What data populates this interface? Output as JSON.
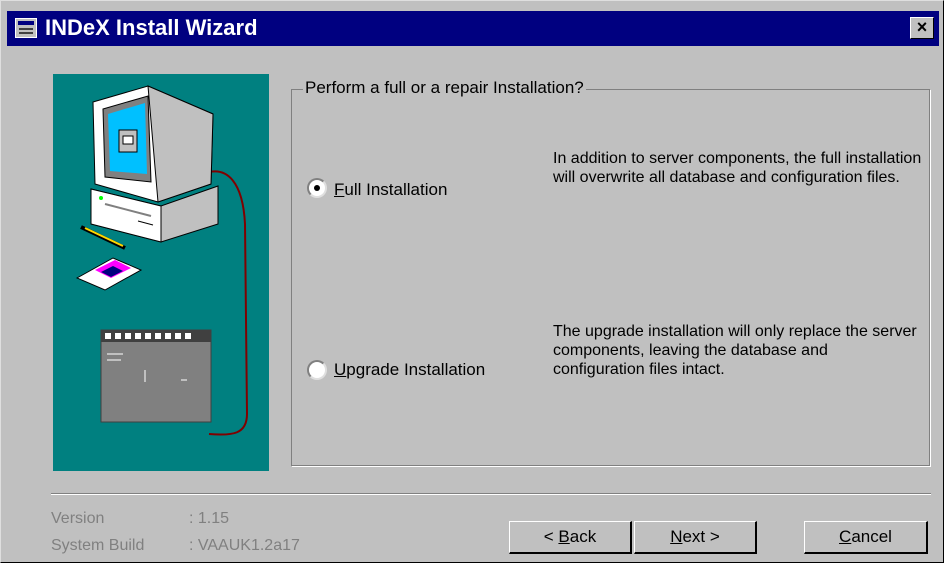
{
  "window": {
    "title": "INDeX Install Wizard",
    "close_label": "×"
  },
  "group": {
    "legend": "Perform a full  or a repair Installation?"
  },
  "options": [
    {
      "label_accel": "F",
      "label_rest": "ull Installation",
      "selected": true,
      "description": "In addition to server components, the full installation will overwrite all database and configuration files."
    },
    {
      "label_accel": "U",
      "label_rest": "pgrade Installation",
      "selected": false,
      "description": "The upgrade installation will only replace the server components, leaving the database and configuration files intact."
    }
  ],
  "info": {
    "version_label": "Version",
    "version_value": ": 1.15",
    "build_label": "System Build",
    "build_value": ": VAAUK1.2a17"
  },
  "buttons": {
    "back_prefix": "< ",
    "back_accel": "B",
    "back_rest": "ack",
    "next_accel": "N",
    "next_rest": "ext >",
    "cancel_accel": "C",
    "cancel_rest": "ancel"
  },
  "colors": {
    "title_bar": "#000080",
    "panel_teal": "#008080",
    "dialog_face": "#c0c0c0"
  }
}
